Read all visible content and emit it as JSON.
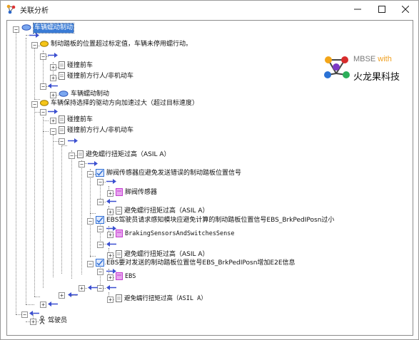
{
  "window": {
    "title": "关联分析",
    "icon": "molecule-app-icon"
  },
  "logo": {
    "mbse": "MBSE",
    "with": "with",
    "company": "火龙果科技"
  },
  "tree": {
    "root": "车辆蠕动制动",
    "n1": "制动踏板的位置超过标定值，车辆未停用蠕行动。",
    "n1a": "碰撞前车",
    "n1b": "碰撞前方行人/非机动车",
    "n1c": "车辆蠕动制动",
    "n2": "车辆保持选择的驱动方向加速过大（超过目标速度）",
    "n2a": "碰撞前车",
    "n2b": "碰撞前方行人/非机动车",
    "n2b1": "避免蠕行扭矩过高（ASIL A）",
    "r1": "脚阀传感器应避免发送错误的制动踏板位置信号",
    "r1a": "脚阀传感器",
    "r1b": "避免蠕行扭矩过高（ASIL A）",
    "r2": "EBS驾驶员请求感知模块应避免计算的制动踏板位置信号EBS_BrkPedIPosn过小",
    "r2a": "BrakingSensorsAndSwitchesSense",
    "r2b": "避免蠕行扭矩过高（ASIL A）",
    "r3": "EBS要对发送的制动踏板位置信号EBS_BrkPedIPosn增加E2E信息",
    "r3a": "EBS",
    "r3b": "避免蠕行扭矩过高（ASIL A）",
    "driver": "驾驶员"
  },
  "colors": {
    "selection": "#3a7bd5",
    "arrow": "#3b4fd0",
    "folder": "#f5c518",
    "requirement": "#2f6fd6",
    "block": "#c43bd0"
  }
}
